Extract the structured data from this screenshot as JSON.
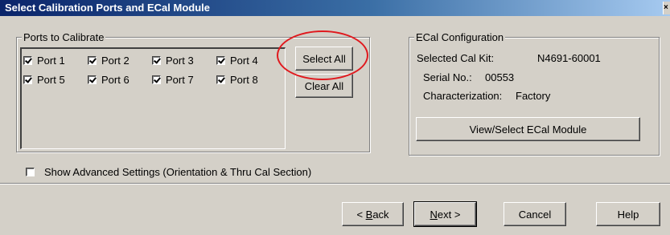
{
  "window": {
    "title": "Select Calibration Ports and ECal Module"
  },
  "ports_group": {
    "legend": "Ports to Calibrate",
    "ports": [
      {
        "label": "Port 1",
        "checked": true
      },
      {
        "label": "Port 2",
        "checked": true
      },
      {
        "label": "Port 3",
        "checked": true
      },
      {
        "label": "Port 4",
        "checked": true
      },
      {
        "label": "Port 5",
        "checked": true
      },
      {
        "label": "Port 6",
        "checked": true
      },
      {
        "label": "Port 7",
        "checked": true
      },
      {
        "label": "Port 8",
        "checked": true
      }
    ],
    "select_all_label": "Select All",
    "clear_all_label": "Clear All"
  },
  "ecal": {
    "legend": "ECal Configuration",
    "selected_cal_kit_label": "Selected Cal Kit:",
    "selected_cal_kit_value": "N4691-60001",
    "serial_label": "Serial No.:",
    "serial_value": "00553",
    "characterization_label": "Characterization:",
    "characterization_value": "Factory",
    "view_select_label": "View/Select ECal Module"
  },
  "advanced": {
    "label": "Show Advanced Settings (Orientation & Thru Cal Section)",
    "checked": false
  },
  "footer": {
    "back_prefix": "< ",
    "back_mnemonic": "B",
    "back_rest": "ack",
    "next_mnemonic": "N",
    "next_rest": "ext >",
    "cancel_label": "Cancel",
    "help_label": "Help"
  },
  "annotation": {
    "highlight_color": "#e0191e"
  }
}
